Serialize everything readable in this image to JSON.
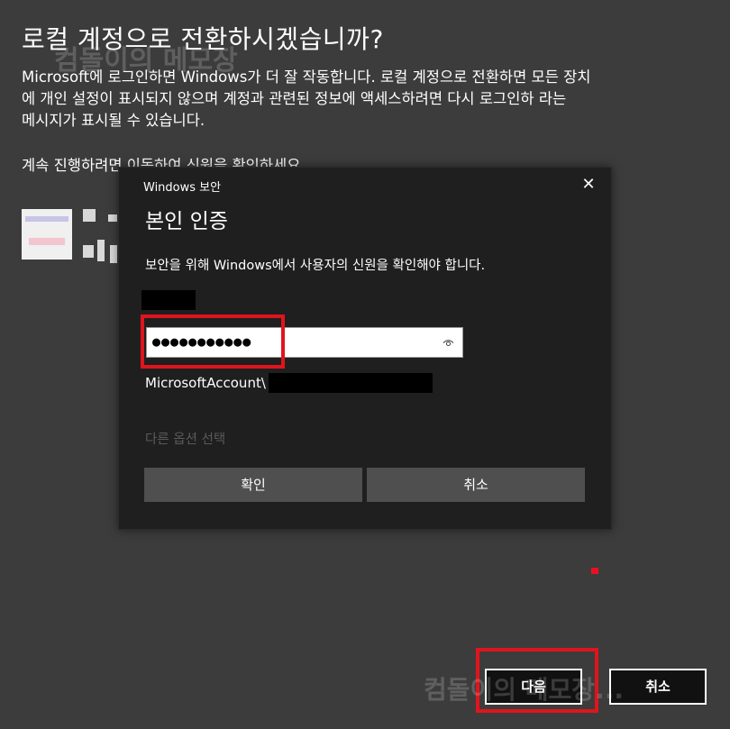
{
  "background": {
    "title": "로컬 계정으로 전환하시겠습니까?",
    "body_lines": [
      "Microsoft에 로그인하면 Windows가 더 잘 작동합니다. 로컬 계정으로 전환하면 모든 장치",
      "에 개인 설정이 표시되지 않으며 계정과 관련된 정보에 액세스하려면 다시 로그인하 라는",
      "메시지가 표시될 수 있습니다."
    ],
    "continue_text": "계속 진행하려면 이동하여 신원을 확인하세요.",
    "next_button": "다음",
    "cancel_button": "취소",
    "watermark_top": "컴돌이의 메모장",
    "watermark_bottom": "컴돌이의 메모장..."
  },
  "dialog": {
    "caption": "Windows 보안",
    "close_glyph": "✕",
    "title": "본인 인증",
    "description": "보안을 위해 Windows에서 사용자의 신원을 확인해야 합니다.",
    "password_value": "●●●●●●●●●●●",
    "domain_prefix": "MicrosoftAccount\\",
    "more_options": "다른 옵션 선택",
    "ok_button": "확인",
    "cancel_button": "취소"
  },
  "colors": {
    "highlight": "#e0141d",
    "background": "#3c3c3c",
    "dialog": "#1f1f1f",
    "button": "#4f4f4f"
  },
  "icons": {
    "close": "close-icon",
    "reveal_password": "eye-icon",
    "avatar": "user-avatar"
  }
}
